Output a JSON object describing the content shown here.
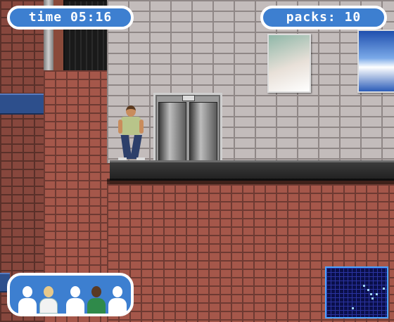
{
  "hud": {
    "time_label": "time",
    "time_value": "05:16",
    "packs_label": "packs:",
    "packs_value": "10"
  },
  "colors": {
    "hud_fill": "#3d7fd0",
    "hud_border": "#ffffff",
    "minimap_bg": "#0a0f4a"
  }
}
